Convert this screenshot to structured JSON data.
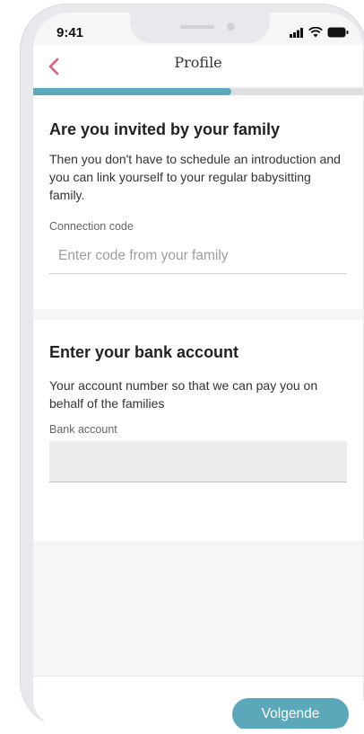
{
  "status_bar": {
    "time": "9:41"
  },
  "header": {
    "title": "Profile"
  },
  "progress": {
    "fraction": 0.6
  },
  "invite_section": {
    "heading": "Are you invited by your family",
    "description": "Then you don't have to schedule an introduction and you can link yourself to your regular babysitting family.",
    "field_label": "Connection code",
    "placeholder": "Enter code from your family",
    "value": ""
  },
  "bank_section": {
    "heading": "Enter your bank account",
    "description": "Your account number so that we can pay you on behalf of the families",
    "field_label": "Bank account",
    "value": ""
  },
  "footer": {
    "next_label": "Volgende"
  },
  "colors": {
    "accent": "#5aa8ba",
    "back_arrow": "#e5587a"
  }
}
